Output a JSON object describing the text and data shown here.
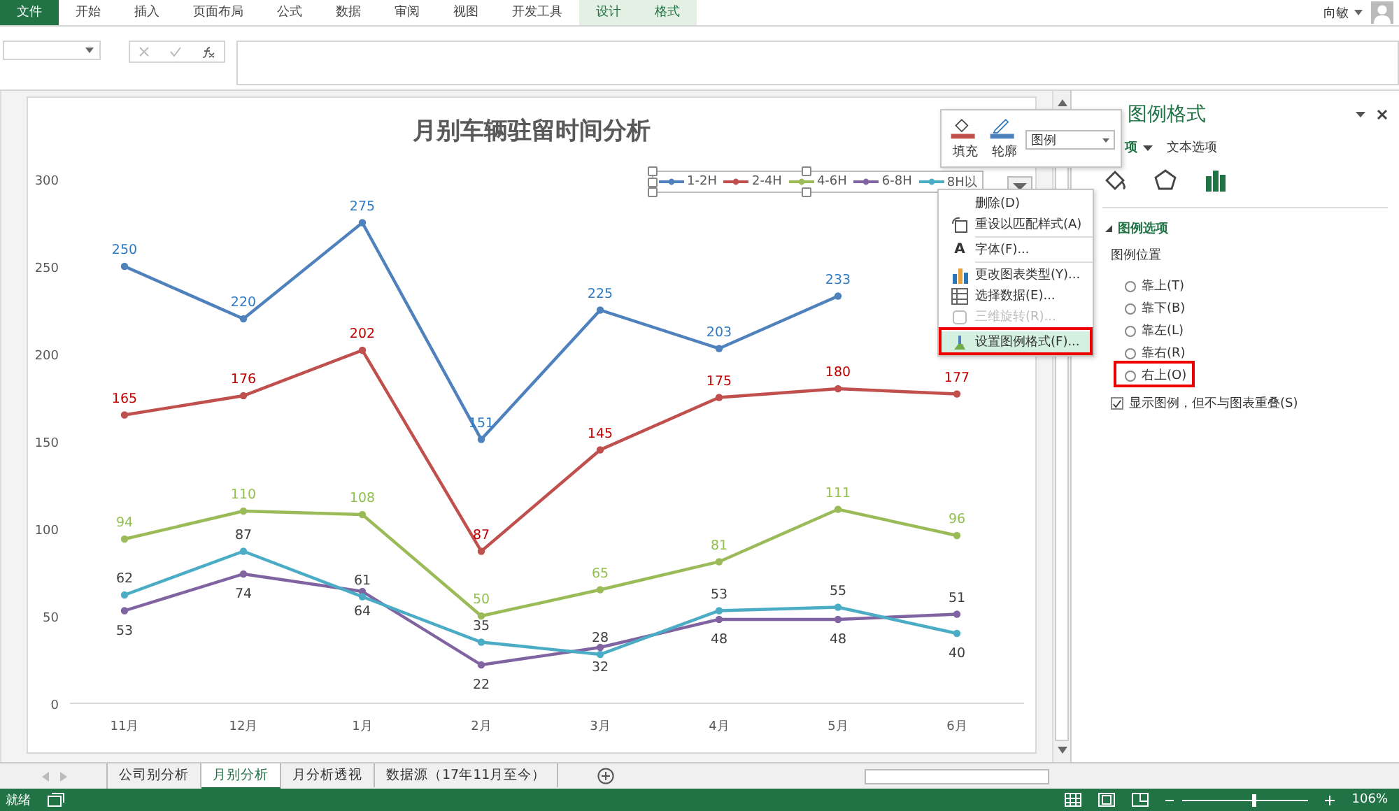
{
  "ribbon": {
    "tabs": [
      {
        "label": "文件",
        "kind": "file"
      },
      {
        "label": "开始",
        "kind": "normal"
      },
      {
        "label": "插入",
        "kind": "normal"
      },
      {
        "label": "页面布局",
        "kind": "normal"
      },
      {
        "label": "公式",
        "kind": "normal"
      },
      {
        "label": "数据",
        "kind": "normal"
      },
      {
        "label": "审阅",
        "kind": "normal"
      },
      {
        "label": "视图",
        "kind": "normal"
      },
      {
        "label": "开发工具",
        "kind": "normal"
      },
      {
        "label": "设计",
        "kind": "contextual"
      },
      {
        "label": "格式",
        "kind": "contextual"
      }
    ],
    "user": "向敏"
  },
  "chart": {
    "chart_data": {
      "type": "line",
      "title": "月别车辆驻留时间分析",
      "categories": [
        "11月",
        "12月",
        "1月",
        "2月",
        "3月",
        "4月",
        "5月",
        "6月"
      ],
      "ylim": [
        0,
        300
      ],
      "yticks": [
        0,
        50,
        100,
        150,
        200,
        250,
        300
      ],
      "series": [
        {
          "name": "1-2H",
          "color": "#4f81bd",
          "marker": true,
          "values": [
            250,
            220,
            275,
            151,
            225,
            203,
            233,
            null
          ],
          "value_labels": [
            "250",
            "220",
            "275",
            "151",
            "225",
            "203",
            "233",
            null
          ]
        },
        {
          "name": "2-4H",
          "color": "#c0504d",
          "marker": true,
          "values": [
            165,
            176,
            202,
            87,
            145,
            175,
            180,
            177
          ],
          "value_labels": [
            "165",
            "176",
            "202",
            "87",
            "145",
            "175",
            "180",
            "177"
          ]
        },
        {
          "name": "4-6H",
          "color": "#9bbb59",
          "marker": true,
          "values": [
            94,
            110,
            108,
            50,
            65,
            81,
            111,
            96
          ],
          "value_labels": [
            "94",
            "110",
            "108",
            "50",
            "65",
            "81",
            "111",
            "96"
          ]
        },
        {
          "name": "6-8H",
          "color": "#8064a2",
          "marker": true,
          "values": [
            53,
            74,
            64,
            22,
            32,
            48,
            48,
            51
          ],
          "value_labels": [
            "53",
            "74",
            "64",
            "22",
            "32",
            "48",
            "48",
            "51"
          ]
        },
        {
          "name": "8H以",
          "color": "#4bacc6",
          "marker": true,
          "values": [
            62,
            87,
            61,
            35,
            28,
            53,
            55,
            40
          ],
          "value_labels": [
            "62",
            "87",
            "61",
            "35",
            "28",
            "53",
            "55",
            "40"
          ]
        }
      ]
    }
  },
  "mini_toolbar": {
    "buttons": [
      {
        "label": "填充",
        "kind": "fill"
      },
      {
        "label": "轮廓",
        "kind": "outline"
      }
    ],
    "element": "图例"
  },
  "context_menu": [
    {
      "label": "删除(D)",
      "kind": "none",
      "disabled": false,
      "highlighted": false,
      "separator_after": false
    },
    {
      "label": "重设以匹配样式(A)",
      "kind": "reset",
      "disabled": false,
      "highlighted": false,
      "separator_after": true
    },
    {
      "label": "字体(F)...",
      "kind": "font",
      "icon_text": "A",
      "disabled": false,
      "highlighted": false,
      "separator_after": true
    },
    {
      "label": "更改图表类型(Y)...",
      "kind": "chart",
      "disabled": false,
      "highlighted": false,
      "separator_after": false
    },
    {
      "label": "选择数据(E)...",
      "kind": "data",
      "disabled": false,
      "highlighted": false,
      "separator_after": false
    },
    {
      "label": "三维旋转(R)...",
      "kind": "rotate",
      "disabled": true,
      "highlighted": false,
      "separator_after": true
    },
    {
      "label": "设置图例格式(F)...",
      "kind": "format",
      "disabled": false,
      "highlighted": true,
      "separator_after": false
    }
  ],
  "pane": {
    "title": "图例格式",
    "tabs": [
      {
        "label": "项",
        "selected": true
      },
      {
        "label": "文本选项",
        "selected": false
      }
    ],
    "icon_tabs": [
      {
        "kind": "fill",
        "selected": false
      },
      {
        "kind": "effects",
        "selected": false
      },
      {
        "kind": "bars",
        "selected": true
      }
    ],
    "section": {
      "title": "图例选项",
      "expanded": true,
      "subtitle": "图例位置",
      "positions": [
        {
          "label": "靠上(T)",
          "selected": false,
          "highlighted": false
        },
        {
          "label": "靠下(B)",
          "selected": false,
          "highlighted": false
        },
        {
          "label": "靠左(L)",
          "selected": false,
          "highlighted": false
        },
        {
          "label": "靠右(R)",
          "selected": false,
          "highlighted": false
        },
        {
          "label": "右上(O)",
          "selected": false,
          "highlighted": true
        }
      ],
      "overlap_option": {
        "label": "显示图例，但不与图表重叠(S)",
        "checked": true
      }
    }
  },
  "sheet_tabs": [
    {
      "label": "公司别分析",
      "selected": false
    },
    {
      "label": "月别分析",
      "selected": true
    },
    {
      "label": "月分析透视",
      "selected": false
    },
    {
      "label": "数据源（17年11月至今）",
      "selected": false
    }
  ],
  "status_bar": {
    "text": "就绪",
    "zoom": {
      "level": 0.55
    },
    "zoom_text": "106%"
  }
}
